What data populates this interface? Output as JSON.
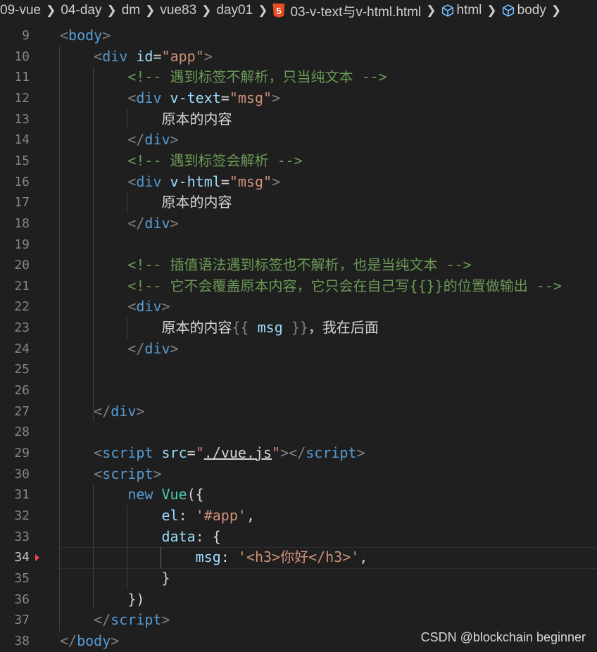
{
  "breadcrumb": {
    "items": [
      "09-vue",
      "04-day",
      "dm",
      "vue83",
      "day01",
      "03-v-text与v-html.html",
      "html",
      "body"
    ],
    "html5_badge": "5"
  },
  "editor": {
    "language": "html",
    "active_line": 34,
    "lines": [
      {
        "n": "9",
        "tokens": [
          [
            "brk",
            "<"
          ],
          [
            "tag",
            "body"
          ],
          [
            "brk",
            ">"
          ]
        ]
      },
      {
        "n": "10",
        "tokens": [
          [
            "txt",
            "    "
          ],
          [
            "brk",
            "<"
          ],
          [
            "tag",
            "div"
          ],
          [
            "txt",
            " "
          ],
          [
            "attr",
            "id"
          ],
          [
            "txt",
            "="
          ],
          [
            "str",
            "\"app\""
          ],
          [
            "brk",
            ">"
          ]
        ]
      },
      {
        "n": "11",
        "tokens": [
          [
            "txt",
            "        "
          ],
          [
            "cmt",
            "<!-- 遇到标签不解析，只当纯文本 -->"
          ]
        ]
      },
      {
        "n": "12",
        "tokens": [
          [
            "txt",
            "        "
          ],
          [
            "brk",
            "<"
          ],
          [
            "tag",
            "div"
          ],
          [
            "txt",
            " "
          ],
          [
            "attr",
            "v-text"
          ],
          [
            "txt",
            "="
          ],
          [
            "str",
            "\"msg\""
          ],
          [
            "brk",
            ">"
          ]
        ]
      },
      {
        "n": "13",
        "tokens": [
          [
            "txt",
            "            原本的内容"
          ]
        ]
      },
      {
        "n": "14",
        "tokens": [
          [
            "txt",
            "        "
          ],
          [
            "brk",
            "</"
          ],
          [
            "tag",
            "div"
          ],
          [
            "brk",
            ">"
          ]
        ]
      },
      {
        "n": "15",
        "tokens": [
          [
            "txt",
            "        "
          ],
          [
            "cmt",
            "<!-- 遇到标签会解析 -->"
          ]
        ]
      },
      {
        "n": "16",
        "tokens": [
          [
            "txt",
            "        "
          ],
          [
            "brk",
            "<"
          ],
          [
            "tag",
            "div"
          ],
          [
            "txt",
            " "
          ],
          [
            "attr",
            "v-html"
          ],
          [
            "txt",
            "="
          ],
          [
            "str",
            "\"msg\""
          ],
          [
            "brk",
            ">"
          ]
        ]
      },
      {
        "n": "17",
        "tokens": [
          [
            "txt",
            "            原本的内容"
          ]
        ]
      },
      {
        "n": "18",
        "tokens": [
          [
            "txt",
            "        "
          ],
          [
            "brk",
            "</"
          ],
          [
            "tag",
            "div"
          ],
          [
            "brk",
            ">"
          ]
        ]
      },
      {
        "n": "19",
        "tokens": []
      },
      {
        "n": "20",
        "tokens": [
          [
            "txt",
            "        "
          ],
          [
            "cmt",
            "<!-- 插值语法遇到标签也不解析，也是当纯文本 -->"
          ]
        ]
      },
      {
        "n": "21",
        "tokens": [
          [
            "txt",
            "        "
          ],
          [
            "cmt",
            "<!-- 它不会覆盖原本内容，它只会在自己写{{}}的位置做输出 -->"
          ]
        ]
      },
      {
        "n": "22",
        "tokens": [
          [
            "txt",
            "        "
          ],
          [
            "brk",
            "<"
          ],
          [
            "tag",
            "div"
          ],
          [
            "brk",
            ">"
          ]
        ]
      },
      {
        "n": "23",
        "tokens": [
          [
            "txt",
            "            原本的内容"
          ],
          [
            "mustache",
            "{{"
          ],
          [
            "txt",
            " "
          ],
          [
            "attr",
            "msg"
          ],
          [
            "txt",
            " "
          ],
          [
            "mustache",
            "}}"
          ],
          [
            "txt",
            "，我在后面"
          ]
        ]
      },
      {
        "n": "24",
        "tokens": [
          [
            "txt",
            "        "
          ],
          [
            "brk",
            "</"
          ],
          [
            "tag",
            "div"
          ],
          [
            "brk",
            ">"
          ]
        ]
      },
      {
        "n": "25",
        "tokens": []
      },
      {
        "n": "26",
        "tokens": []
      },
      {
        "n": "27",
        "tokens": [
          [
            "txt",
            "    "
          ],
          [
            "brk",
            "</"
          ],
          [
            "tag",
            "div"
          ],
          [
            "brk",
            ">"
          ]
        ]
      },
      {
        "n": "28",
        "tokens": []
      },
      {
        "n": "29",
        "tokens": [
          [
            "txt",
            "    "
          ],
          [
            "brk",
            "<"
          ],
          [
            "tag",
            "script"
          ],
          [
            "txt",
            " "
          ],
          [
            "attr",
            "src"
          ],
          [
            "txt",
            "="
          ],
          [
            "str",
            "\""
          ],
          [
            "link",
            "./vue.js"
          ],
          [
            "str",
            "\""
          ],
          [
            "brk",
            "></"
          ],
          [
            "tag",
            "script"
          ],
          [
            "brk",
            ">"
          ]
        ]
      },
      {
        "n": "30",
        "tokens": [
          [
            "txt",
            "    "
          ],
          [
            "brk",
            "<"
          ],
          [
            "tag",
            "script"
          ],
          [
            "brk",
            ">"
          ]
        ]
      },
      {
        "n": "31",
        "tokens": [
          [
            "txt",
            "        "
          ],
          [
            "kw",
            "new"
          ],
          [
            "txt",
            " "
          ],
          [
            "cls",
            "Vue"
          ],
          [
            "punc",
            "({"
          ]
        ]
      },
      {
        "n": "32",
        "tokens": [
          [
            "txt",
            "            "
          ],
          [
            "attr",
            "el"
          ],
          [
            "punc",
            ": "
          ],
          [
            "str",
            "'#app'"
          ],
          [
            "punc",
            ","
          ]
        ]
      },
      {
        "n": "33",
        "tokens": [
          [
            "txt",
            "            "
          ],
          [
            "attr",
            "data"
          ],
          [
            "punc",
            ": {"
          ]
        ]
      },
      {
        "n": "34",
        "tokens": [
          [
            "txt",
            "                "
          ],
          [
            "attr",
            "msg"
          ],
          [
            "punc",
            ": "
          ],
          [
            "str",
            "'<h3>你好</h3>'"
          ],
          [
            "punc",
            ","
          ]
        ]
      },
      {
        "n": "35",
        "tokens": [
          [
            "txt",
            "            "
          ],
          [
            "punc",
            "}"
          ]
        ]
      },
      {
        "n": "36",
        "tokens": [
          [
            "txt",
            "        "
          ],
          [
            "punc",
            "})"
          ]
        ]
      },
      {
        "n": "37",
        "tokens": [
          [
            "txt",
            "    "
          ],
          [
            "brk",
            "</"
          ],
          [
            "tag",
            "script"
          ],
          [
            "brk",
            ">"
          ]
        ]
      },
      {
        "n": "38",
        "tokens": [
          [
            "brk",
            "</"
          ],
          [
            "tag",
            "body"
          ],
          [
            "brk",
            ">"
          ]
        ]
      }
    ]
  },
  "watermark": "CSDN @blockchain beginner",
  "colors": {
    "background": "#1f1f1f",
    "tag": "#569cd6",
    "attribute": "#9cdcfe",
    "string": "#ce9178",
    "comment": "#6a9955",
    "line_number": "#858585"
  },
  "icons": {
    "breadcrumb_separator": "chevron-right-icon",
    "file_type": "html5-icon",
    "symbol": "cube-icon"
  }
}
